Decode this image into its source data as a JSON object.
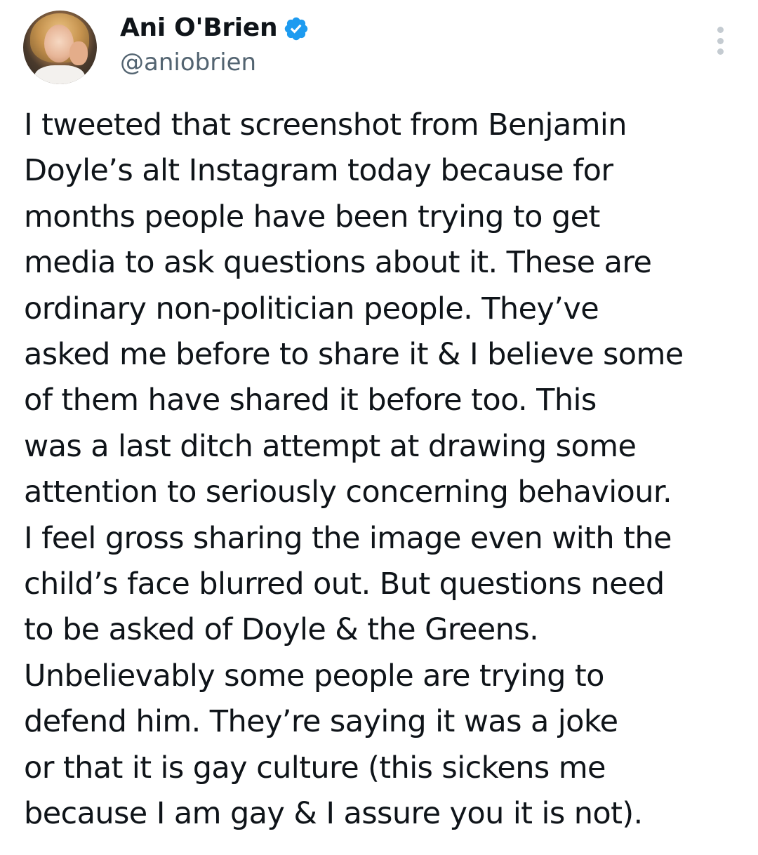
{
  "tweet": {
    "author": {
      "display_name": "Ani O'Brien",
      "handle": "@aniobrien",
      "verified": true,
      "verified_color": "#1d9bf0",
      "avatar_icon": "profile-photo"
    },
    "more_icon": "vertical-ellipsis-icon",
    "text_lines": [
      "I tweeted that screenshot from Benjamin",
      "Doyle’s alt Instagram today because for",
      "months people have been trying to get",
      "media to ask questions about it. These are",
      "ordinary non-politician people. They’ve",
      "asked me before to share it & I believe some",
      "of them have shared it before too. This",
      "was a last ditch attempt at drawing some",
      "attention to seriously concerning behaviour.",
      "I feel gross sharing the image even with the",
      "child’s face blurred out. But questions need",
      "to be asked of Doyle & the Greens.",
      "Unbelievably some people are trying to",
      "defend him. They’re saying it was a joke",
      "or that it is gay culture (this sickens me",
      "because I am gay & I assure you it is not)."
    ]
  },
  "colors": {
    "text": "#0f1419",
    "secondary_text": "#536471",
    "background": "#ffffff",
    "more_dots": "#c4cbd1"
  }
}
